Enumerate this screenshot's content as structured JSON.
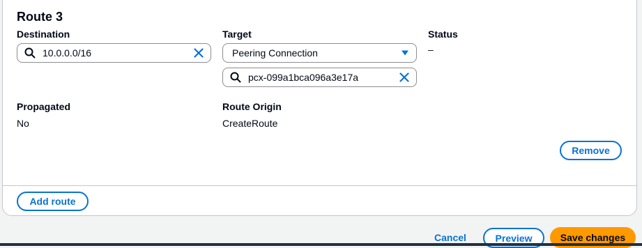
{
  "route": {
    "title": "Route 3",
    "destination": {
      "label": "Destination",
      "value": "10.0.0.0/16"
    },
    "target": {
      "label": "Target",
      "type_value": "Peering Connection",
      "id_value": "pcx-099a1bca096a3e17a"
    },
    "status": {
      "label": "Status",
      "value": "–"
    },
    "propagated": {
      "label": "Propagated",
      "value": "No"
    },
    "origin": {
      "label": "Route Origin",
      "value": "CreateRoute"
    },
    "remove_label": "Remove"
  },
  "add_route_label": "Add route",
  "footer": {
    "cancel_label": "Cancel",
    "preview_label": "Preview",
    "save_label": "Save changes"
  },
  "colors": {
    "accent": "#0972d3",
    "primary_button": "#ff9900",
    "text": "#000716",
    "border": "#8c8c94"
  },
  "icons": [
    "search-icon",
    "clear-icon",
    "caret-down-icon"
  ]
}
